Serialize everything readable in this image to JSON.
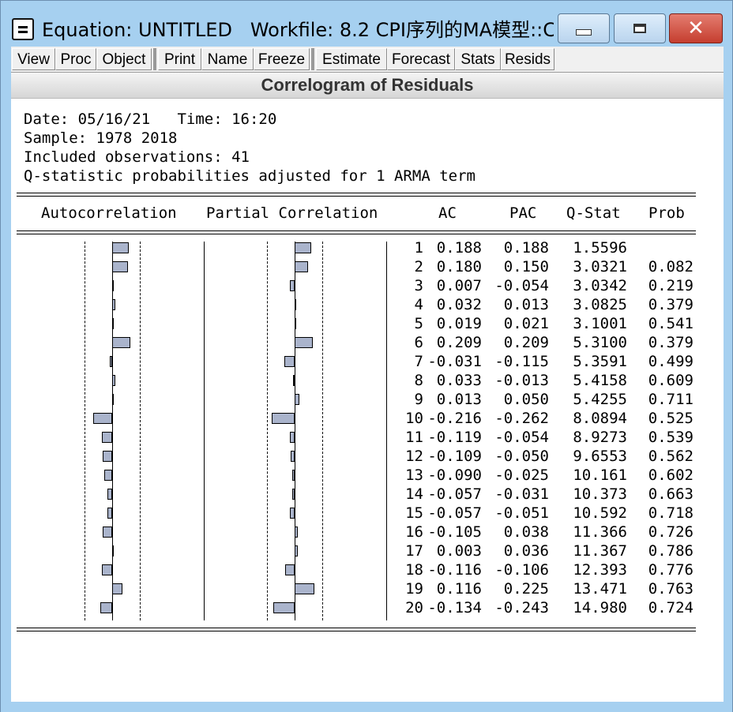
{
  "window": {
    "title": "Equation: UNTITLED   Workfile: 8.2 CPI序列的MA模型::C...",
    "minimize_label": "minimize",
    "maximize_label": "maximize",
    "close_label": "close"
  },
  "toolbar": {
    "buttons": [
      "View",
      "Proc",
      "Object",
      "Print",
      "Name",
      "Freeze",
      "Estimate",
      "Forecast",
      "Stats",
      "Resids"
    ]
  },
  "header": {
    "title": "Correlogram of Residuals"
  },
  "info": {
    "date_line": "Date: 05/16/21   Time: 16:20",
    "sample_line": "Sample: 1978 2018",
    "obs_line": "Included observations: 41",
    "note_line": "Q-statistic probabilities adjusted for 1 ARMA term"
  },
  "columns": {
    "autocorrelation": "Autocorrelation",
    "partial": "Partial Correlation",
    "ac": "AC",
    "pac": "PAC",
    "qstat": "Q-Stat",
    "prob": "Prob"
  },
  "rows": [
    {
      "lag": "1",
      "ac": "0.188",
      "pac": "0.188",
      "q": "1.5596",
      "prob": ""
    },
    {
      "lag": "2",
      "ac": "0.180",
      "pac": "0.150",
      "q": "3.0321",
      "prob": "0.082"
    },
    {
      "lag": "3",
      "ac": "0.007",
      "pac": "-0.054",
      "q": "3.0342",
      "prob": "0.219"
    },
    {
      "lag": "4",
      "ac": "0.032",
      "pac": "0.013",
      "q": "3.0825",
      "prob": "0.379"
    },
    {
      "lag": "5",
      "ac": "0.019",
      "pac": "0.021",
      "q": "3.1001",
      "prob": "0.541"
    },
    {
      "lag": "6",
      "ac": "0.209",
      "pac": "0.209",
      "q": "5.3100",
      "prob": "0.379"
    },
    {
      "lag": "7",
      "ac": "-0.031",
      "pac": "-0.115",
      "q": "5.3591",
      "prob": "0.499"
    },
    {
      "lag": "8",
      "ac": "0.033",
      "pac": "-0.013",
      "q": "5.4158",
      "prob": "0.609"
    },
    {
      "lag": "9",
      "ac": "0.013",
      "pac": "0.050",
      "q": "5.4255",
      "prob": "0.711"
    },
    {
      "lag": "10",
      "ac": "-0.216",
      "pac": "-0.262",
      "q": "8.0894",
      "prob": "0.525"
    },
    {
      "lag": "11",
      "ac": "-0.119",
      "pac": "-0.054",
      "q": "8.9273",
      "prob": "0.539"
    },
    {
      "lag": "12",
      "ac": "-0.109",
      "pac": "-0.050",
      "q": "9.6553",
      "prob": "0.562"
    },
    {
      "lag": "13",
      "ac": "-0.090",
      "pac": "-0.025",
      "q": "10.161",
      "prob": "0.602"
    },
    {
      "lag": "14",
      "ac": "-0.057",
      "pac": "-0.031",
      "q": "10.373",
      "prob": "0.663"
    },
    {
      "lag": "15",
      "ac": "-0.057",
      "pac": "-0.051",
      "q": "10.592",
      "prob": "0.718"
    },
    {
      "lag": "16",
      "ac": "-0.105",
      "pac": "0.038",
      "q": "11.366",
      "prob": "0.726"
    },
    {
      "lag": "17",
      "ac": "0.003",
      "pac": "0.036",
      "q": "11.367",
      "prob": "0.786"
    },
    {
      "lag": "18",
      "ac": "-0.116",
      "pac": "-0.106",
      "q": "12.393",
      "prob": "0.776"
    },
    {
      "lag": "19",
      "ac": "0.116",
      "pac": "0.225",
      "q": "13.471",
      "prob": "0.763"
    },
    {
      "lag": "20",
      "ac": "-0.134",
      "pac": "-0.243",
      "q": "14.980",
      "prob": "0.724"
    }
  ],
  "colors": {
    "bar_fill": "#aab4cc",
    "title_bg": "#a6d0f0",
    "close_red": "#c53e2f"
  }
}
